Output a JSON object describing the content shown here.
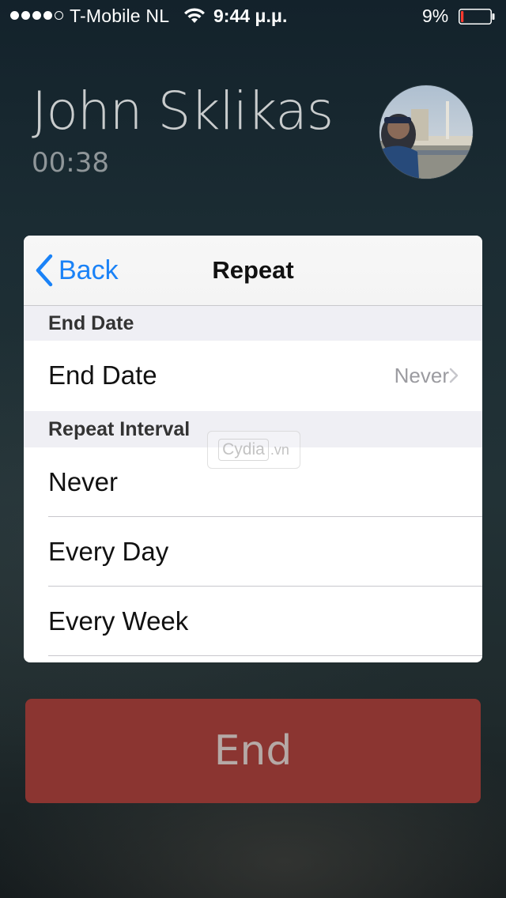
{
  "status_bar": {
    "carrier": "T-Mobile NL",
    "time": "9:44 μ.μ.",
    "battery_percent": "9%",
    "signal_bars_filled": 4,
    "signal_bars_total": 5,
    "battery_level": 0.09,
    "wifi_icon": "wifi-icon",
    "battery_color": "#ff3b30"
  },
  "call": {
    "caller_name": "John Sklikas",
    "duration": "00:38"
  },
  "panel": {
    "back_label": "Back",
    "title": "Repeat",
    "accent_color": "#1a82f7",
    "section_end_date": "End Date",
    "end_date_row": {
      "label": "End Date",
      "value": "Never"
    },
    "section_repeat_interval": "Repeat Interval",
    "interval_options": [
      {
        "label": "Never"
      },
      {
        "label": "Every Day"
      },
      {
        "label": "Every Week"
      }
    ]
  },
  "watermark": {
    "main": "Cydia",
    "tld": ".vn"
  },
  "end_button": {
    "label": "End",
    "color": "#8b3531"
  }
}
